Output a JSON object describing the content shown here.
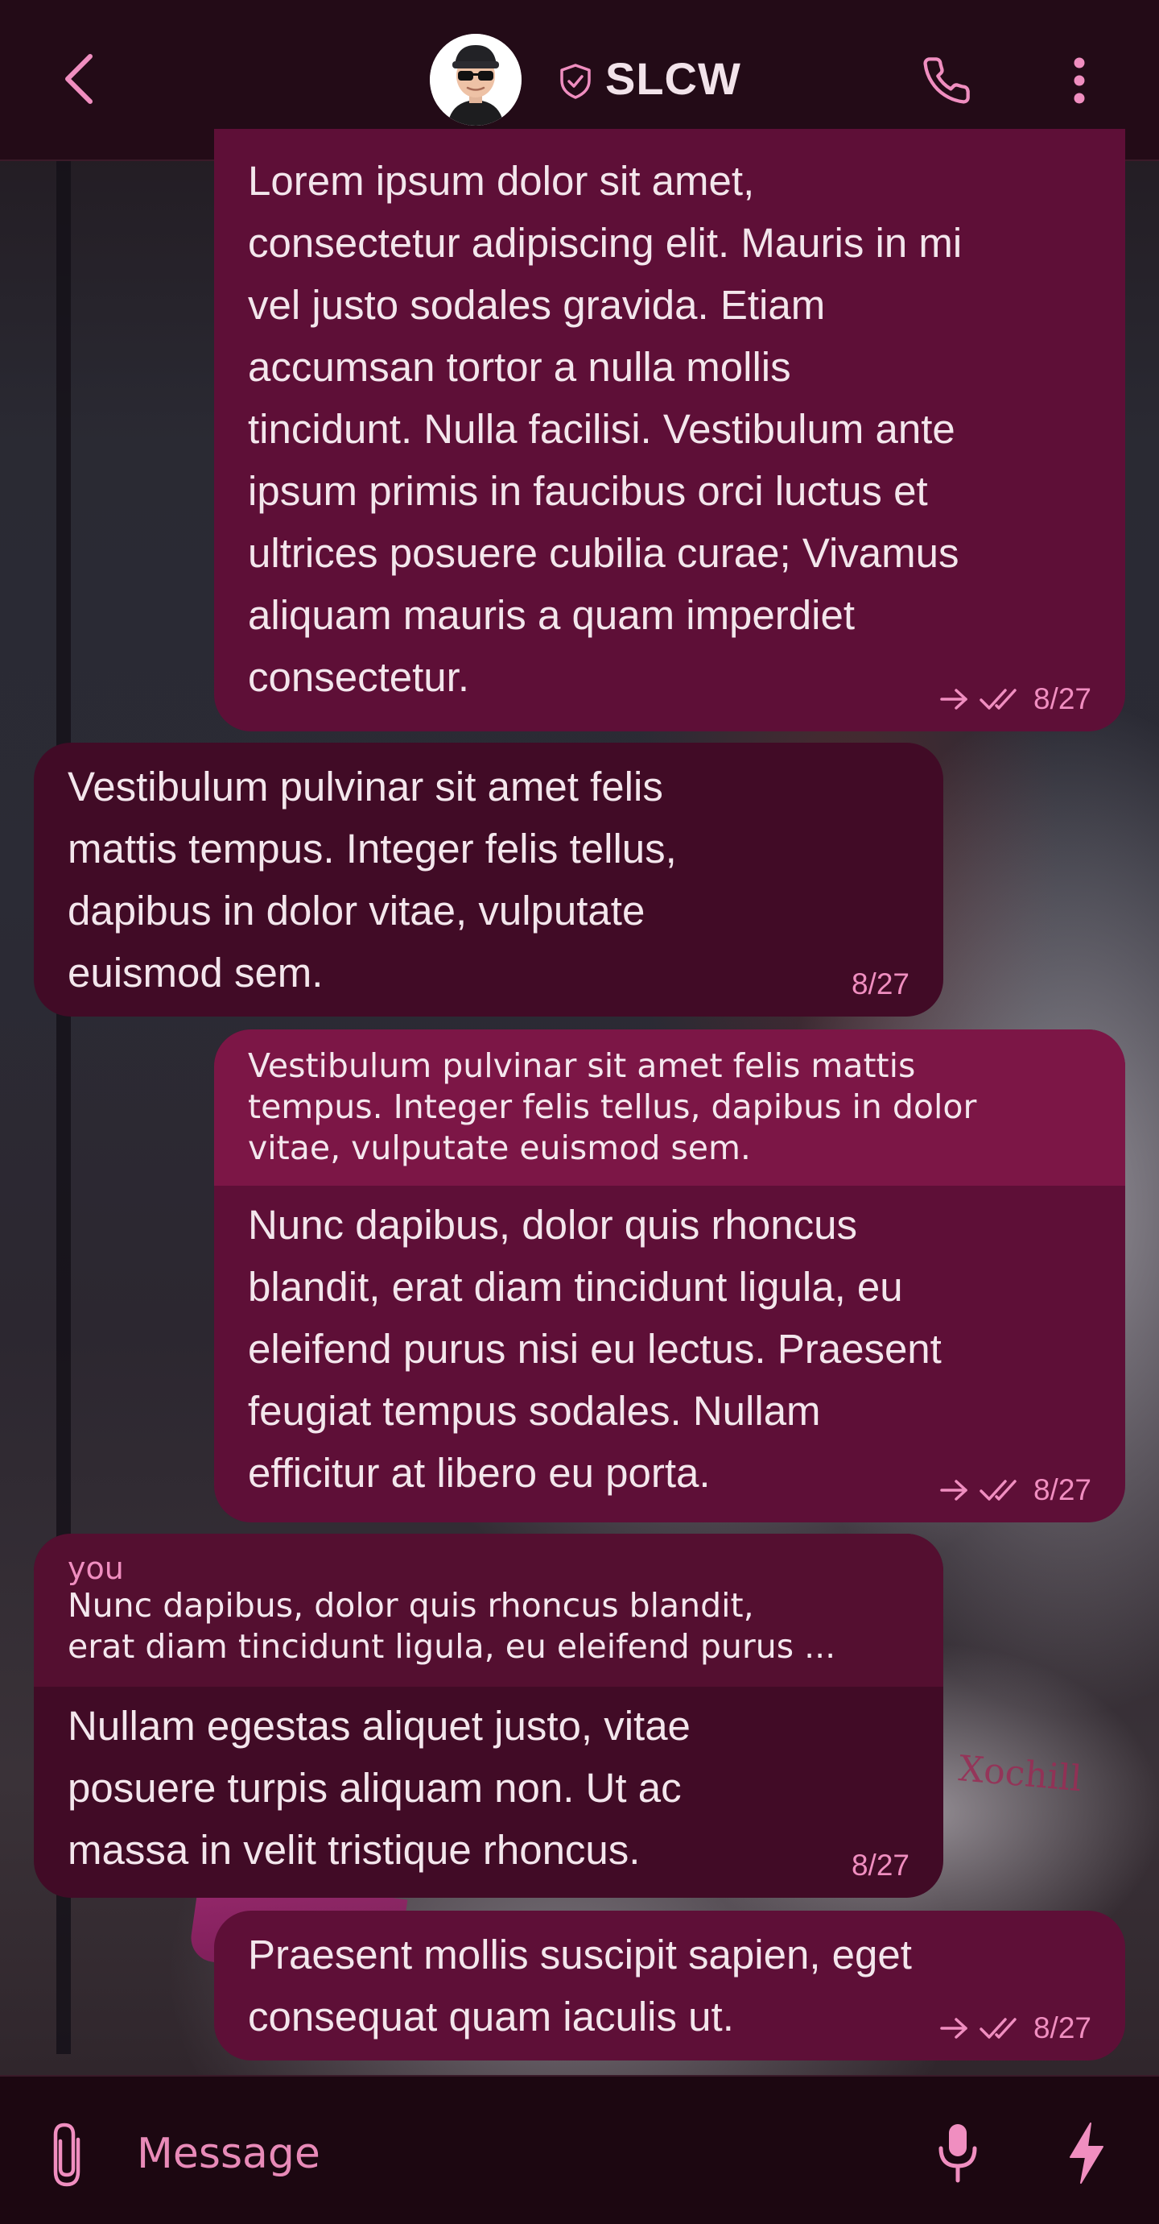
{
  "header": {
    "title": "SLCW",
    "back_icon": "chevron-left-icon",
    "verified_icon": "shield-check-icon",
    "call_icon": "phone-icon",
    "menu_icon": "more-vertical-icon",
    "avatar": "memoji-avatar-sunglasses-cap"
  },
  "colors": {
    "accent": "#f08ec0",
    "outgoing_bubble": "#5e0f37",
    "incoming_bubble": "#410b26",
    "quote_outgoing": "#7c1646",
    "quote_incoming": "#540f30",
    "header_bg": "#230b17"
  },
  "messages": [
    {
      "direction": "outgoing",
      "text": "Lorem ipsum dolor sit amet,\nconsectetur adipiscing elit. Mauris in mi\nvel justo sodales gravida. Etiam\naccumsan tortor a nulla mollis\ntincidunt. Nulla facilisi. Vestibulum ante\nipsum primis in faucibus orci luctus et\nultrices posuere cubilia curae; Vivamus\naliquam mauris a quam imperdiet\nconsectetur.",
      "date": "8/27",
      "status_icons": [
        "forwarded-arrow-icon",
        "double-check-icon"
      ]
    },
    {
      "direction": "incoming",
      "text": "Vestibulum pulvinar sit amet felis\nmattis tempus. Integer felis tellus,\ndapibus in dolor vitae, vulputate\neuismod sem.",
      "date": "8/27"
    },
    {
      "direction": "outgoing",
      "quote": {
        "text": "Vestibulum pulvinar sit amet felis mattis\ntempus. Integer felis tellus, dapibus in dolor\nvitae, vulputate euismod sem."
      },
      "text": "Nunc dapibus, dolor quis rhoncus\nblandit, erat diam tincidunt ligula, eu\neleifend purus nisi eu lectus. Praesent\nfeugiat tempus sodales. Nullam\nefficitur at libero eu porta.",
      "date": "8/27",
      "status_icons": [
        "forwarded-arrow-icon",
        "double-check-icon"
      ]
    },
    {
      "direction": "incoming",
      "quote": {
        "author": "you",
        "text": "Nunc dapibus, dolor quis rhoncus blandit,\nerat diam tincidunt ligula, eu eleifend purus ..."
      },
      "text": "Nullam egestas aliquet justo, vitae\nposuere turpis aliquam non. Ut ac\nmassa in velit tristique rhoncus.",
      "date": "8/27"
    },
    {
      "direction": "outgoing",
      "text": "Praesent mollis suscipit sapien, eget\nconsequat quam iaculis ut.",
      "date": "8/27",
      "status_icons": [
        "forwarded-arrow-icon",
        "double-check-icon"
      ]
    }
  ],
  "wallpaper": {
    "tag_text": "Xochill"
  },
  "composer": {
    "placeholder": "Message",
    "value": "",
    "attach_icon": "paperclip-icon",
    "mic_icon": "microphone-icon",
    "bolt_icon": "lightning-icon"
  }
}
